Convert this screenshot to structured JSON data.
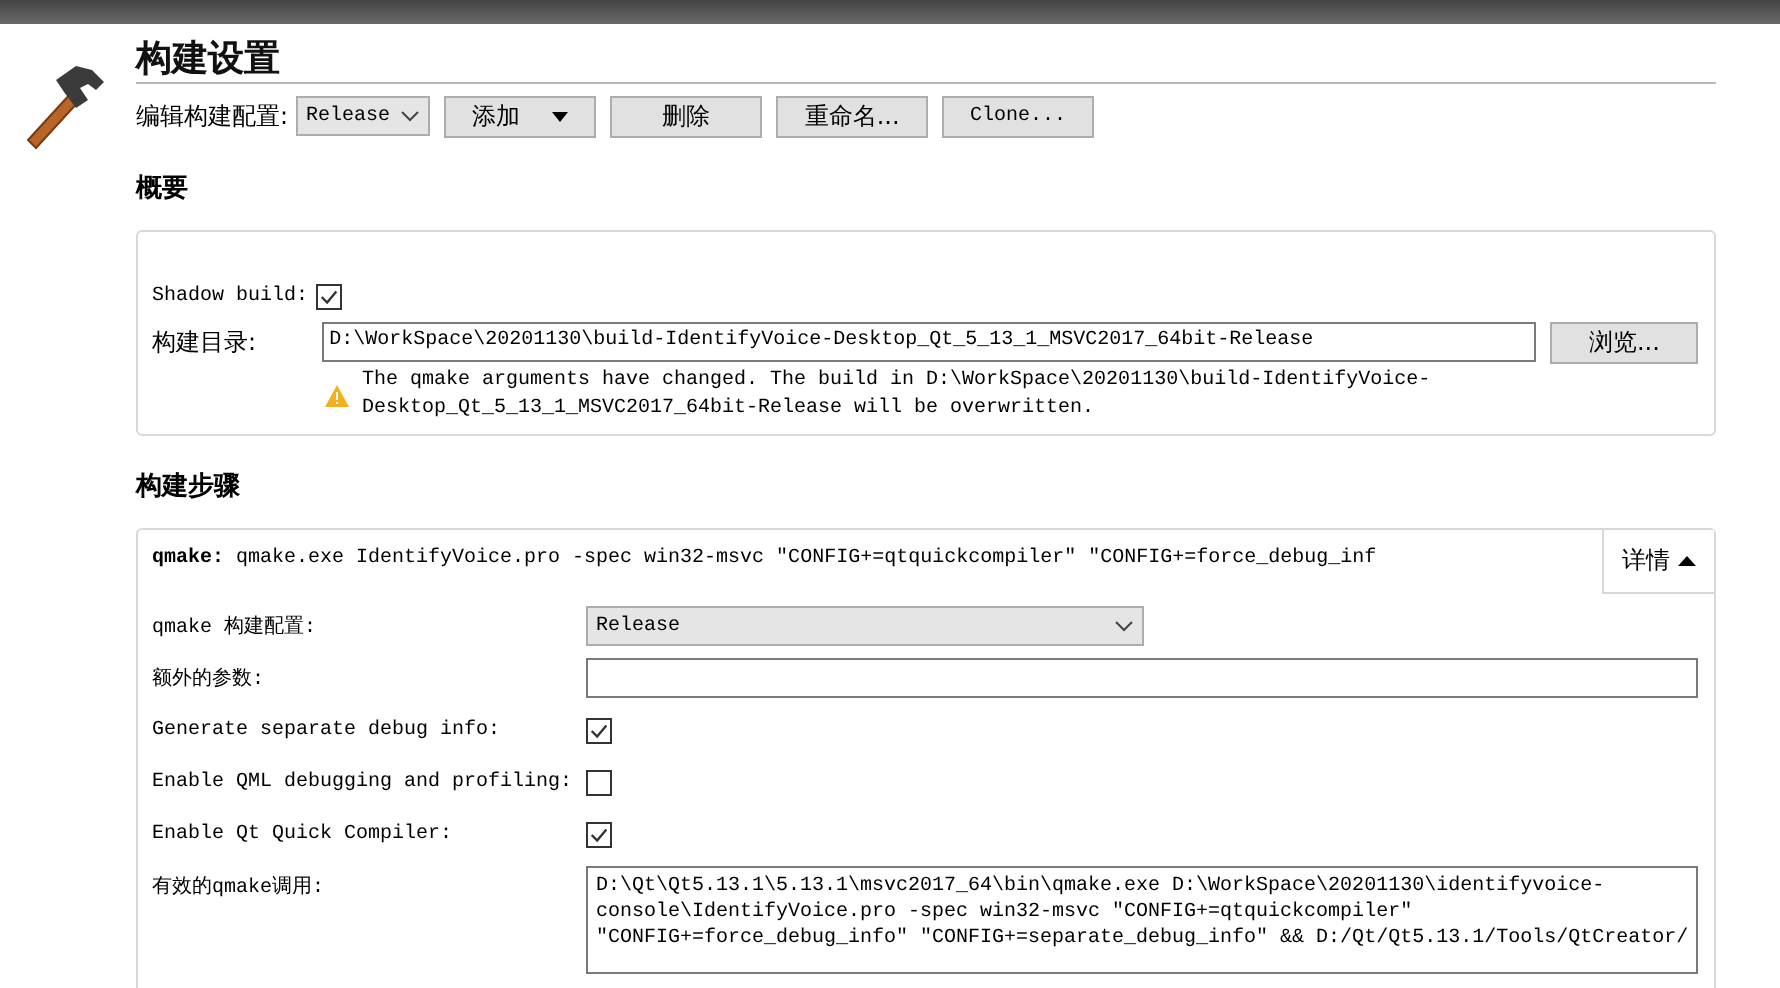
{
  "header": {
    "title": "构建设置"
  },
  "config_bar": {
    "label": "编辑构建配置:",
    "config": "Release",
    "buttons": [
      {
        "label": "添加",
        "kind": "menu"
      },
      {
        "label": "删除",
        "kind": "plain"
      },
      {
        "label": "重命名...",
        "kind": "plain"
      },
      {
        "label": "Clone...",
        "kind": "plain"
      }
    ]
  },
  "summary": {
    "heading": "概要",
    "shadow_build": {
      "label": "Shadow build:",
      "checked": true
    },
    "build_dir": {
      "label": "构建目录:",
      "value": "D:\\WorkSpace\\20201130\\build-IdentifyVoice-Desktop_Qt_5_13_1_MSVC2017_64bit-Release",
      "browse": "浏览..."
    },
    "warning": "The qmake arguments have changed. The build in D:\\WorkSpace\\20201130\\build-IdentifyVoice-Desktop_Qt_5_13_1_MSVC2017_64bit-Release will be overwritten."
  },
  "build_steps": {
    "heading": "构建步骤",
    "step": {
      "name": "qmake:",
      "command": "qmake.exe IdentifyVoice.pro -spec win32-msvc \"CONFIG+=qtquickcompiler\" \"CONFIG+=force_debug_inf",
      "details": "详情",
      "expanded": true
    },
    "fields": [
      {
        "kind": "select",
        "label": "qmake 构建配置:",
        "value": "Release"
      },
      {
        "kind": "text",
        "label": "额外的参数:"
      },
      {
        "kind": "check",
        "label": "Generate separate debug info:",
        "checked": true
      },
      {
        "kind": "check",
        "label": "Enable QML debugging and profiling:",
        "checked": false
      },
      {
        "kind": "check",
        "label": "Enable Qt Quick Compiler:",
        "checked": true
      },
      {
        "kind": "textarea",
        "label": "有效的qmake调用:",
        "lines": [
          "D:\\Qt\\Qt5.13.1\\5.13.1\\msvc2017_64\\bin\\qmake.exe D:\\WorkSpace\\20201130\\identifyvoice-",
          "console\\IdentifyVoice.pro -spec win32-msvc \"CONFIG+=qtquickcompiler\"",
          "\"CONFIG+=force_debug_info\" \"CONFIG+=separate_debug_info\" && D:/Qt/Qt5.13.1/Tools/QtCreator/"
        ]
      }
    ]
  }
}
